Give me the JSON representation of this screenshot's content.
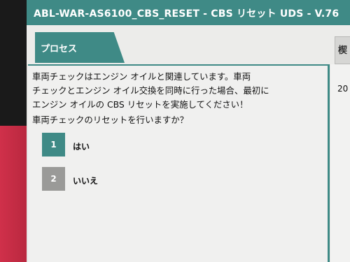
{
  "window": {
    "title": "ABL-WAR-AS6100_CBS_RESET - CBS リセット UDS - V.76"
  },
  "tabs": {
    "active": "プロセス",
    "next_partial": "楔"
  },
  "main": {
    "message_lines": [
      "車両チェックはエンジン オイルと関連しています。車両",
      "チェックとエンジン オイル交換を同時に行った場合、最初に",
      "エンジン オイルの CBS リセットを実施してください！"
    ],
    "question": "車両チェックのリセットを行いますか？",
    "options": [
      {
        "number": "1",
        "label": "はい"
      },
      {
        "number": "2",
        "label": "いいえ"
      }
    ]
  },
  "right_panel": {
    "value": "20"
  },
  "colors": {
    "accent": "#3f8a86",
    "secondary_button": "#9a9a98",
    "background": "#f0f0ef"
  }
}
